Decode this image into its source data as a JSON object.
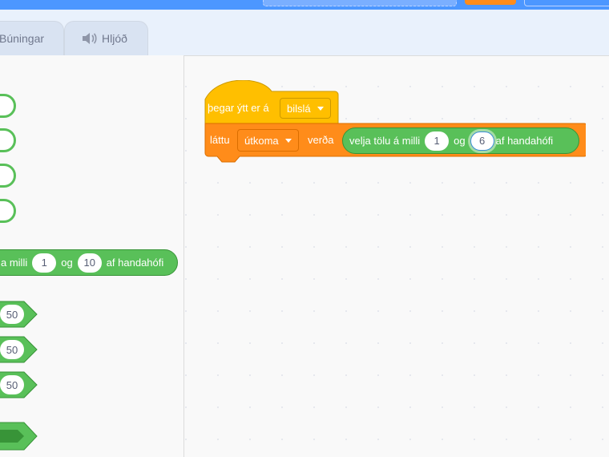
{
  "tabs": {
    "costumes": "Búningar",
    "sounds": "Hljóð"
  },
  "palette": {
    "random_block": {
      "prefix": "a milli",
      "from": "1",
      "and": "og",
      "to": "10",
      "suffix": "af handahófi"
    },
    "hex_values": [
      "50",
      "50",
      "50"
    ]
  },
  "script": {
    "hat": {
      "label": "þegar ýtt er á",
      "key": "bilslá"
    },
    "set": {
      "label": "láttu",
      "variable": "útkoma",
      "to": "verða"
    },
    "random": {
      "prefix": "velja tölu á milli",
      "from": "1",
      "and": "og",
      "to": "6",
      "suffix": "af handahófi"
    }
  },
  "colors": {
    "events": "#ffbf00",
    "variables": "#ff8c1a",
    "operators": "#59c059",
    "topbar": "#4c97ff"
  }
}
